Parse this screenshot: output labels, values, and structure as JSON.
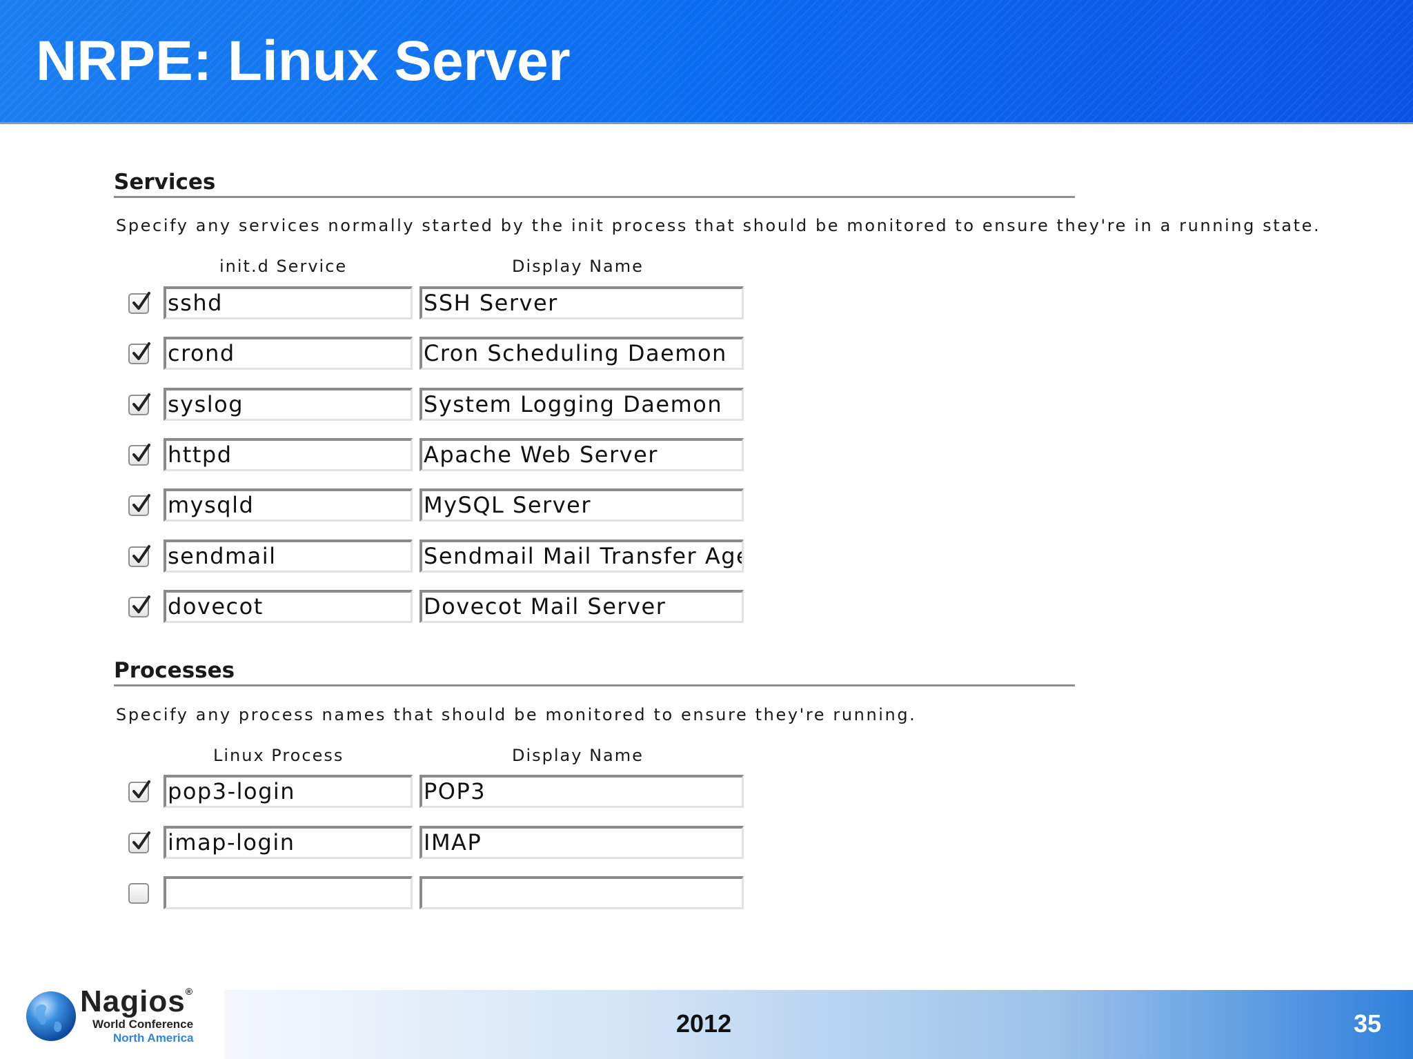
{
  "slide": {
    "title": "NRPE: Linux Server"
  },
  "services": {
    "heading": "Services",
    "description": "Specify any services normally started by the init process that should be monitored to ensure they're in a running state.",
    "col1": "init.d Service",
    "col2": "Display Name",
    "rows": [
      {
        "checked": true,
        "service": "sshd",
        "display": "SSH Server"
      },
      {
        "checked": true,
        "service": "crond",
        "display": "Cron Scheduling Daemon"
      },
      {
        "checked": true,
        "service": "syslog",
        "display": "System Logging Daemon"
      },
      {
        "checked": true,
        "service": "httpd",
        "display": "Apache Web Server"
      },
      {
        "checked": true,
        "service": "mysqld",
        "display": "MySQL Server"
      },
      {
        "checked": true,
        "service": "sendmail",
        "display": "Sendmail Mail Transfer Age"
      },
      {
        "checked": true,
        "service": "dovecot",
        "display": "Dovecot Mail Server"
      }
    ]
  },
  "processes": {
    "heading": "Processes",
    "description": "Specify any process names that should be monitored to ensure they're running.",
    "col1": "Linux Process",
    "col2": "Display Name",
    "rows": [
      {
        "checked": true,
        "service": "pop3-login",
        "display": "POP3"
      },
      {
        "checked": true,
        "service": "imap-login",
        "display": "IMAP"
      },
      {
        "checked": false,
        "service": "",
        "display": ""
      }
    ]
  },
  "footer": {
    "logo_name": "Nagios",
    "logo_reg": "®",
    "logo_line1": "World Conference",
    "logo_line2": "North America",
    "year": "2012",
    "page_number": "35"
  },
  "colors": {
    "header_blue": "#0a6cf0",
    "footer_accent": "#2f86d8"
  }
}
